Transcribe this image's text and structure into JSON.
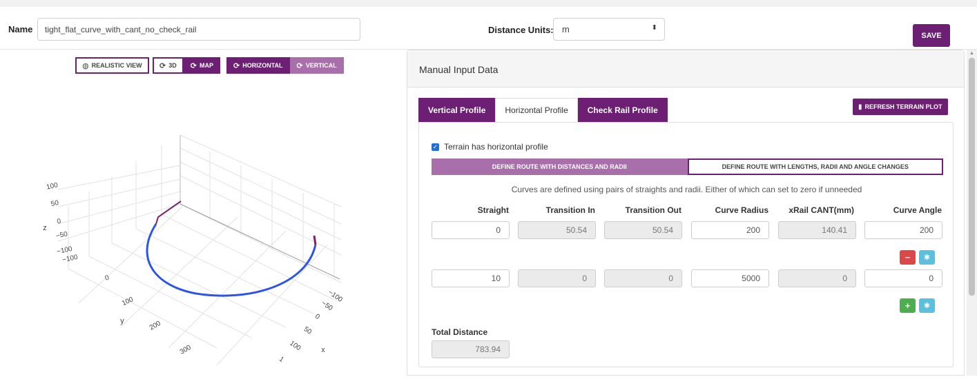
{
  "header": {
    "name_label": "Name",
    "name_value": "tight_flat_curve_with_cant_no_check_rail",
    "units_label": "Distance Units:",
    "units_value": "m",
    "save_label": "SAVE"
  },
  "view_controls": {
    "realistic": "REALISTIC VIEW",
    "three_d": "3D",
    "map": "MAP",
    "horizontal": "HORIZONTAL",
    "vertical": "VERTICAL"
  },
  "plot": {
    "z_axis": "z",
    "y_axis": "y",
    "x_axis": "x",
    "z_ticks": [
      "100",
      "50",
      "0",
      "−50",
      "−100",
      "−100"
    ],
    "y_ticks": [
      "0",
      "100",
      "200",
      "300"
    ],
    "x_ticks": [
      "−100",
      "−50",
      "0",
      "50",
      "100",
      "1"
    ],
    "curve_color": "#2d54e8",
    "end_color": "#7a1f6a"
  },
  "panel": {
    "title": "Manual Input Data",
    "tabs": [
      "Vertical Profile",
      "Horizontal Profile",
      "Check Rail Profile"
    ],
    "refresh_label": "REFRESH TERRAIN PLOT",
    "checkbox_label": "Terrain has horizontal profile",
    "mode_a": "DEFINE ROUTE WITH DISTANCES AND RADII",
    "mode_b": "DEFINE ROUTE WITH LENGTHS, RADII AND ANGLE CHANGES",
    "hint": "Curves are defined using pairs of straights and radii. Either of which can set to zero if unneeded",
    "columns": [
      "Straight",
      "Transition In",
      "Transition Out",
      "Curve Radius",
      "xRail CANT(mm)",
      "Curve Angle"
    ],
    "rows": [
      [
        "0",
        "50.54",
        "50.54",
        "200",
        "140.41",
        "200"
      ],
      [
        "10",
        "0",
        "0",
        "5000",
        "0",
        "0"
      ]
    ],
    "total_label": "Total Distance",
    "total_value": "783.94"
  },
  "colors": {
    "brand": "#6d1f73",
    "brand_light": "#a86fab",
    "remove": "#dc4848",
    "settings": "#5bc0de",
    "add": "#4cae4c"
  }
}
